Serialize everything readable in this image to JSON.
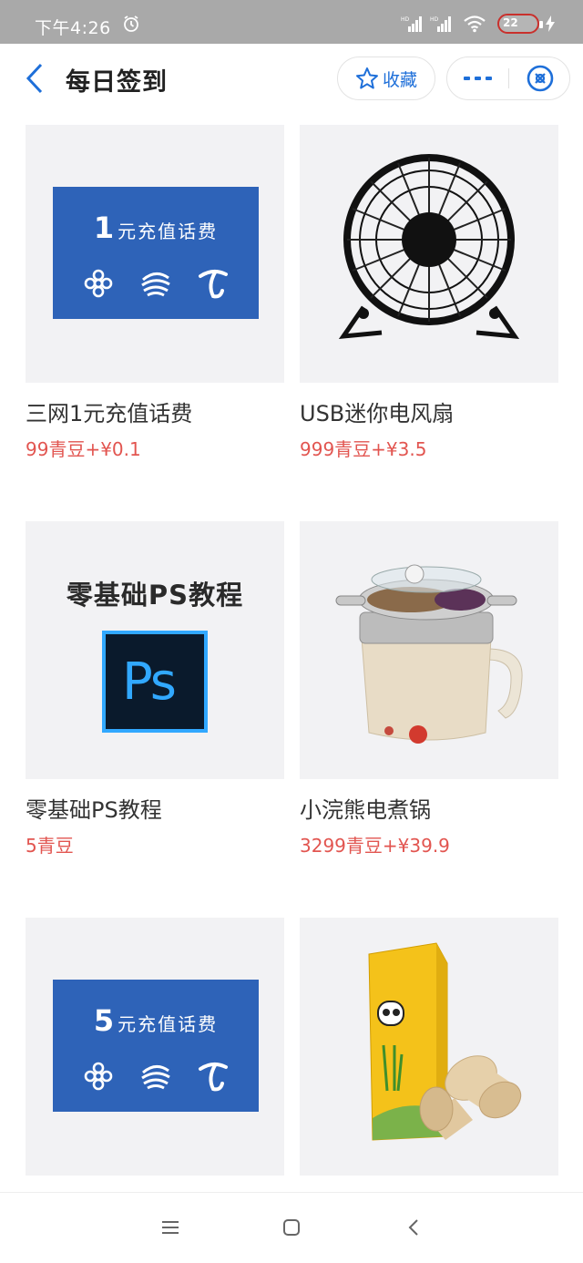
{
  "status_bar": {
    "time": "下午4:26",
    "battery_level": "22",
    "icons": [
      "alarm-icon",
      "signal-hd-icon",
      "signal-hd-icon",
      "wifi-icon",
      "battery-icon",
      "charging-icon"
    ]
  },
  "nav": {
    "title": "每日签到",
    "favorite_label": "收藏",
    "icons": [
      "back-arrow-icon",
      "star-icon",
      "more-icon",
      "close-circle-icon"
    ],
    "accent_color": "#1e6fd9"
  },
  "products": [
    {
      "name": "三网1元充值话费",
      "price": "99青豆+¥0.1",
      "image": {
        "type": "recharge",
        "amount": "1",
        "text": "元充值话费"
      }
    },
    {
      "name": "USB迷你电风扇",
      "price": "999青豆+¥3.5",
      "image": {
        "type": "fan-icon"
      }
    },
    {
      "name": "零基础PS教程",
      "price": "5青豆",
      "image": {
        "type": "ps-course",
        "heading": "零基础PS教程",
        "logo_text": "Ps"
      }
    },
    {
      "name": "小浣熊电煮锅",
      "price": "3299青豆+¥39.9",
      "image": {
        "type": "cooker-icon"
      }
    },
    {
      "name": "",
      "price": "",
      "image": {
        "type": "recharge",
        "amount": "5",
        "text": "元充值话费"
      }
    },
    {
      "name": "",
      "price": "",
      "image": {
        "type": "tissue-roll-icon"
      }
    }
  ],
  "colors": {
    "price": "#e25550",
    "recharge_panel": "#2e63b8",
    "image_bg": "#f2f2f4"
  },
  "bottom_nav": {
    "icons": [
      "menu-icon",
      "home-square-icon",
      "back-chevron-icon"
    ]
  }
}
